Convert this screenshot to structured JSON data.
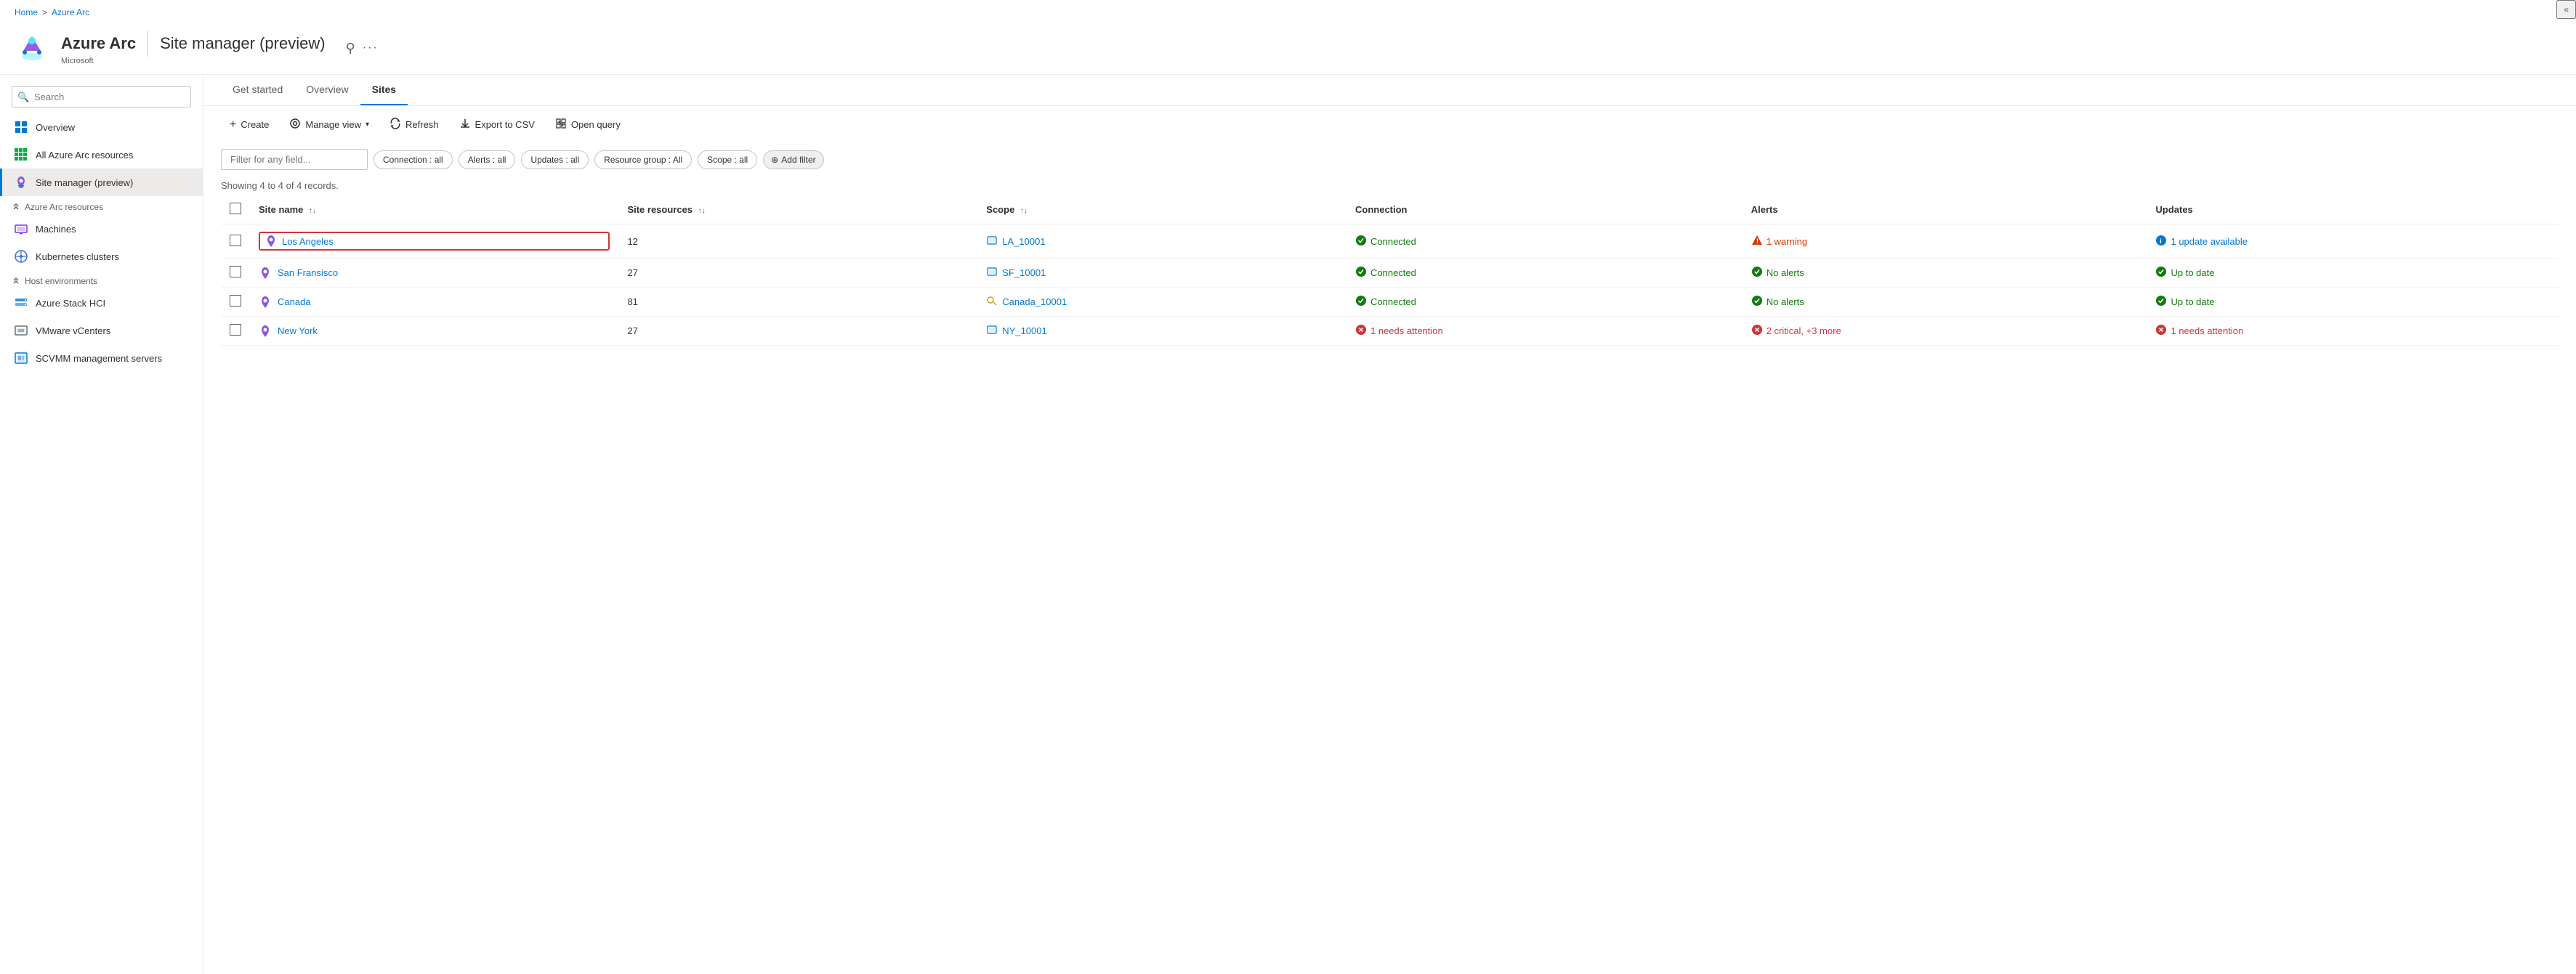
{
  "breadcrumb": {
    "home": "Home",
    "separator": ">",
    "current": "Azure Arc"
  },
  "header": {
    "app_name": "Azure Arc",
    "divider": "|",
    "page_title": "Site manager (preview)",
    "subtitle": "Microsoft"
  },
  "sidebar": {
    "search_placeholder": "Search",
    "collapse_label": "«",
    "items": [
      {
        "id": "overview",
        "label": "Overview",
        "icon": "overview-icon"
      },
      {
        "id": "all-resources",
        "label": "All Azure Arc resources",
        "icon": "resources-icon"
      },
      {
        "id": "site-manager",
        "label": "Site manager (preview)",
        "icon": "site-icon",
        "active": true
      },
      {
        "id": "azure-arc-resources",
        "label": "Azure Arc resources",
        "section": true,
        "collapsed": false
      },
      {
        "id": "machines",
        "label": "Machines",
        "icon": "machines-icon"
      },
      {
        "id": "kubernetes",
        "label": "Kubernetes clusters",
        "icon": "k8s-icon"
      },
      {
        "id": "host-environments",
        "label": "Host environments",
        "section": true,
        "collapsed": false
      },
      {
        "id": "azure-stack-hci",
        "label": "Azure Stack HCI",
        "icon": "hci-icon"
      },
      {
        "id": "vmware-vcenters",
        "label": "VMware vCenters",
        "icon": "vmware-icon"
      },
      {
        "id": "scvmm",
        "label": "SCVMM management servers",
        "icon": "scvmm-icon"
      }
    ]
  },
  "tabs": [
    {
      "id": "get-started",
      "label": "Get started",
      "active": false
    },
    {
      "id": "overview",
      "label": "Overview",
      "active": false
    },
    {
      "id": "sites",
      "label": "Sites",
      "active": true
    }
  ],
  "toolbar": {
    "create": "Create",
    "manage_view": "Manage view",
    "refresh": "Refresh",
    "export_csv": "Export to CSV",
    "open_query": "Open query"
  },
  "filters": {
    "placeholder": "Filter for any field...",
    "chips": [
      {
        "label": "Connection : all"
      },
      {
        "label": "Alerts : all"
      },
      {
        "label": "Updates : all"
      },
      {
        "label": "Resource group : All"
      },
      {
        "label": "Scope : all"
      }
    ],
    "add_filter": "Add filter"
  },
  "record_count": "Showing 4 to 4 of 4 records.",
  "table": {
    "columns": [
      {
        "id": "site-name",
        "label": "Site name"
      },
      {
        "id": "site-resources",
        "label": "Site resources"
      },
      {
        "id": "scope",
        "label": "Scope"
      },
      {
        "id": "connection",
        "label": "Connection"
      },
      {
        "id": "alerts",
        "label": "Alerts"
      },
      {
        "id": "updates",
        "label": "Updates"
      }
    ],
    "rows": [
      {
        "id": "los-angeles",
        "site_name": "Los Angeles",
        "site_resources": "12",
        "scope_label": "LA_10001",
        "scope_icon": "scope-box-icon",
        "connection_status": "Connected",
        "connection_type": "ok",
        "alerts_text": "1 warning",
        "alerts_type": "warning",
        "updates_text": "1 update available",
        "updates_type": "update",
        "highlighted": true
      },
      {
        "id": "san-fransisco",
        "site_name": "San Fransisco",
        "site_resources": "27",
        "scope_label": "SF_10001",
        "scope_icon": "scope-box-icon",
        "connection_status": "Connected",
        "connection_type": "ok",
        "alerts_text": "No alerts",
        "alerts_type": "ok",
        "updates_text": "Up to date",
        "updates_type": "uptodate",
        "highlighted": false
      },
      {
        "id": "canada",
        "site_name": "Canada",
        "site_resources": "81",
        "scope_label": "Canada_10001",
        "scope_icon": "scope-key-icon",
        "connection_status": "Connected",
        "connection_type": "ok",
        "alerts_text": "No alerts",
        "alerts_type": "ok",
        "updates_text": "Up to date",
        "updates_type": "uptodate",
        "highlighted": false
      },
      {
        "id": "new-york",
        "site_name": "New York",
        "site_resources": "27",
        "scope_label": "NY_10001",
        "scope_icon": "scope-box-icon",
        "connection_status": "1 needs attention",
        "connection_type": "error",
        "alerts_text": "2 critical, +3 more",
        "alerts_type": "error",
        "updates_text": "1 needs attention",
        "updates_type": "error",
        "highlighted": false
      }
    ]
  }
}
